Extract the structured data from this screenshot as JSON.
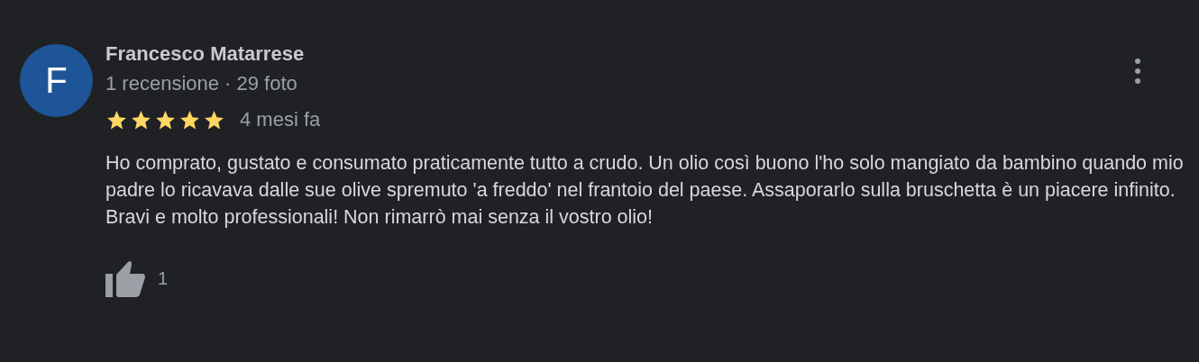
{
  "review": {
    "avatar_letter": "F",
    "author": "Francesco Matarrese",
    "author_meta": "1 recensione · 29 foto",
    "stars": 5,
    "time": "4 mesi fa",
    "text": "Ho comprato, gustato e consumato praticamente tutto a crudo. Un olio così buono l'ho solo mangiato da bambino quando mio padre lo ricavava dalle sue olive spremuto 'a freddo' nel frantoio del paese. Assaporarlo sulla bruschetta è un piacere infinito. Bravi e molto professionali! Non rimarrò mai senza il vostro olio!",
    "likes": "1"
  }
}
